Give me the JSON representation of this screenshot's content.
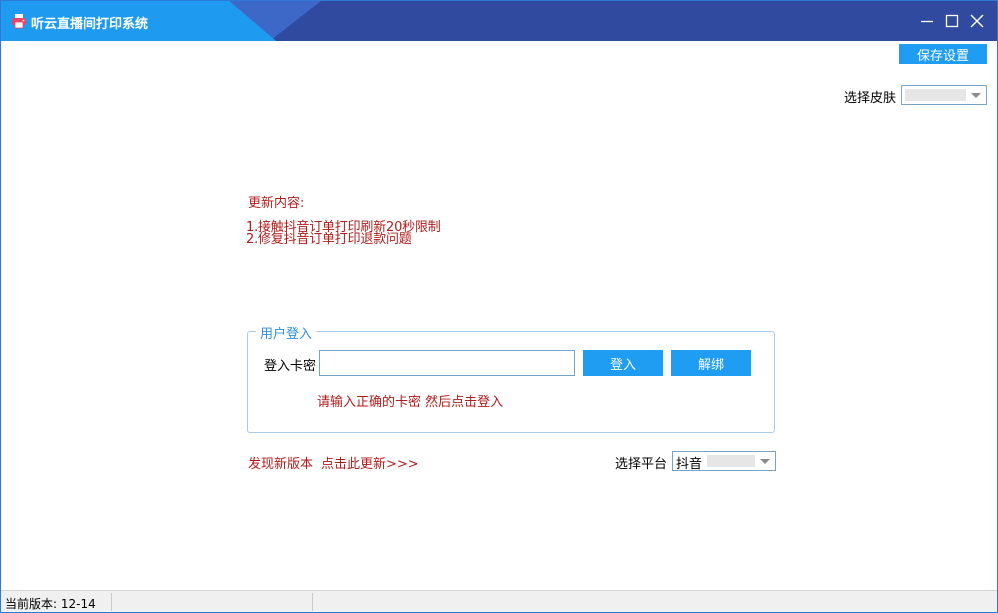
{
  "window": {
    "title": "听云直播间打印系统",
    "icon": "printer-icon",
    "controls": [
      "minimize-icon",
      "maximize-icon",
      "close-icon"
    ]
  },
  "toolbar": {
    "save_label": "保存设置"
  },
  "skin": {
    "label": "选择皮肤",
    "value": ""
  },
  "update": {
    "title": "更新内容:",
    "items": [
      "1.接触抖音订单打印刷新20秒限制",
      "2.修复抖音订单打印退款问题"
    ]
  },
  "login": {
    "group_title": "用户登入",
    "card_label": "登入卡密",
    "card_value": "",
    "login_button": "登入",
    "unbind_button": "解绑",
    "hint": "请输入正确的卡密 然后点击登入"
  },
  "new_version": {
    "label": "发现新版本",
    "link": "点击此更新>>>"
  },
  "platform": {
    "label": "选择平台",
    "value": "抖音"
  },
  "status": {
    "version": "当前版本: 12-14"
  },
  "colors": {
    "accent": "#1e9df2",
    "title_bar": "#2f4a9e",
    "warning_text": "#b01c1c"
  }
}
